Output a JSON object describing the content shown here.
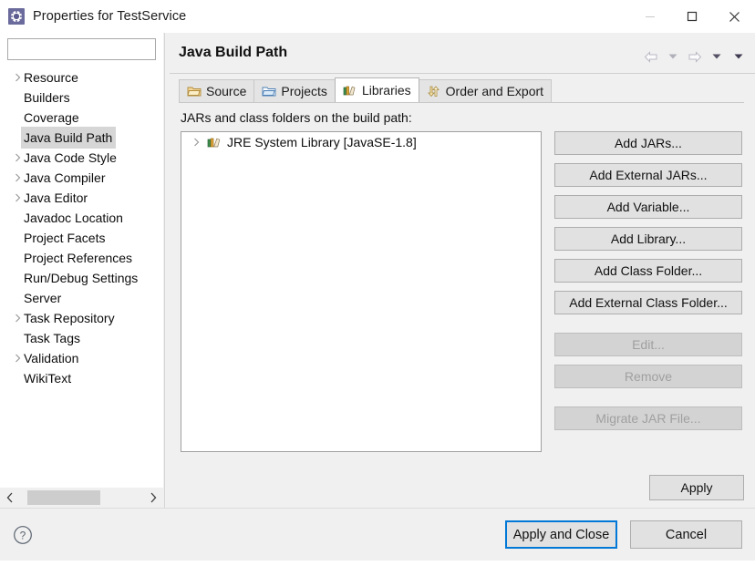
{
  "window": {
    "title": "Properties for TestService",
    "icon": "properties-gear-icon",
    "controls": {
      "minimize": "minimize-icon",
      "maximize": "maximize-icon",
      "close": "close-icon"
    }
  },
  "sidebar": {
    "search": {
      "value": "",
      "placeholder": ""
    },
    "items": [
      {
        "label": "Resource",
        "expandable": true,
        "selected": false
      },
      {
        "label": "Builders",
        "expandable": false,
        "selected": false
      },
      {
        "label": "Coverage",
        "expandable": false,
        "selected": false
      },
      {
        "label": "Java Build Path",
        "expandable": false,
        "selected": true
      },
      {
        "label": "Java Code Style",
        "expandable": true,
        "selected": false
      },
      {
        "label": "Java Compiler",
        "expandable": true,
        "selected": false
      },
      {
        "label": "Java Editor",
        "expandable": true,
        "selected": false
      },
      {
        "label": "Javadoc Location",
        "expandable": false,
        "selected": false
      },
      {
        "label": "Project Facets",
        "expandable": false,
        "selected": false
      },
      {
        "label": "Project References",
        "expandable": false,
        "selected": false
      },
      {
        "label": "Run/Debug Settings",
        "expandable": false,
        "selected": false
      },
      {
        "label": "Server",
        "expandable": false,
        "selected": false
      },
      {
        "label": "Task Repository",
        "expandable": true,
        "selected": false
      },
      {
        "label": "Task Tags",
        "expandable": false,
        "selected": false
      },
      {
        "label": "Validation",
        "expandable": true,
        "selected": false
      },
      {
        "label": "WikiText",
        "expandable": false,
        "selected": false
      }
    ],
    "scrollbar": {
      "left_arrow": "chevron-left-icon",
      "right_arrow": "chevron-right-icon"
    }
  },
  "content": {
    "page_title": "Java Build Path",
    "nav": {
      "back": "arrow-left-icon",
      "back_menu": "chevron-down-icon",
      "forward": "arrow-right-icon",
      "forward_menu": "chevron-down-icon",
      "view_menu": "chevron-down-icon"
    },
    "tabs": [
      {
        "label": "Source",
        "icon": "source-folder-icon",
        "active": false
      },
      {
        "label": "Projects",
        "icon": "projects-folder-icon",
        "active": false
      },
      {
        "label": "Libraries",
        "icon": "libraries-books-icon",
        "active": true
      },
      {
        "label": "Order and Export",
        "icon": "order-export-arrows-icon",
        "active": false
      }
    ],
    "list_label": "JARs and class folders on the build path:",
    "list_items": [
      {
        "label": "JRE System Library [JavaSE-1.8]",
        "icon": "libraries-books-icon",
        "expandable": true
      }
    ],
    "buttons": [
      {
        "label": "Add JARs...",
        "enabled": true,
        "group": 1
      },
      {
        "label": "Add External JARs...",
        "enabled": true,
        "group": 1
      },
      {
        "label": "Add Variable...",
        "enabled": true,
        "group": 1
      },
      {
        "label": "Add Library...",
        "enabled": true,
        "group": 1
      },
      {
        "label": "Add Class Folder...",
        "enabled": true,
        "group": 1
      },
      {
        "label": "Add External Class Folder...",
        "enabled": true,
        "group": 1
      },
      {
        "label": "Edit...",
        "enabled": false,
        "group": 2
      },
      {
        "label": "Remove",
        "enabled": false,
        "group": 2
      },
      {
        "label": "Migrate JAR File...",
        "enabled": false,
        "group": 3
      }
    ],
    "apply_label": "Apply"
  },
  "footer": {
    "help_icon": "help-circle-icon",
    "apply_and_close_label": "Apply and Close",
    "cancel_label": "Cancel",
    "focus_color": "#0078d7"
  }
}
